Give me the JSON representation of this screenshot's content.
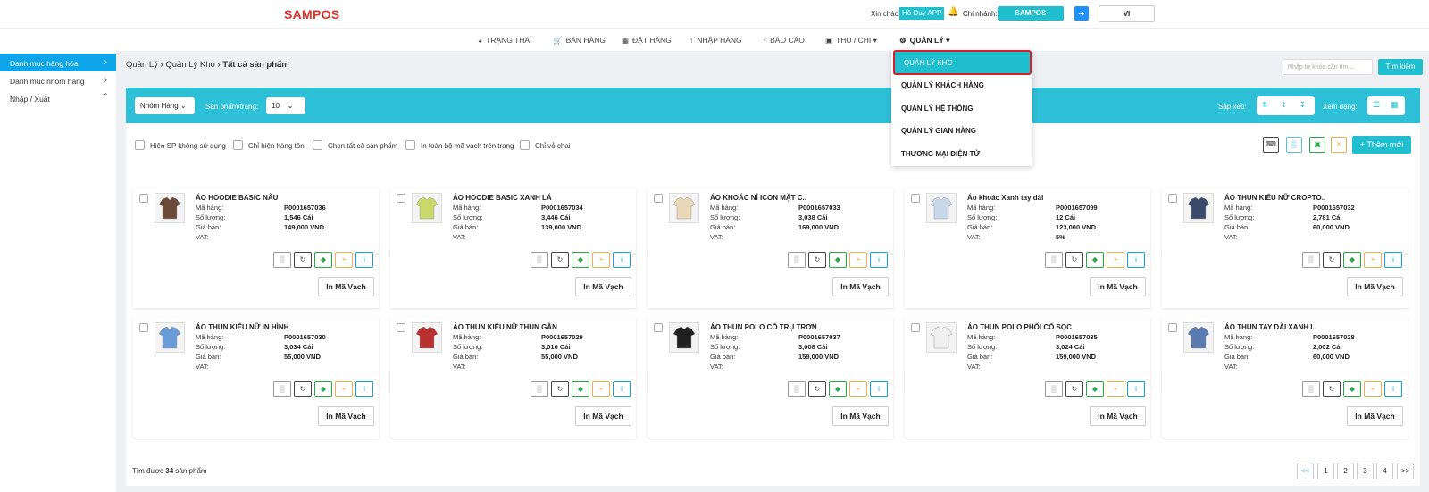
{
  "header": {
    "logo": "SAMPOS",
    "greeting": "Xin chào",
    "user": "Hồ Duy APP",
    "branch_label": "Chi nhánh:",
    "branch": "SAMPOS",
    "lang": "VI"
  },
  "nav": [
    {
      "label": "TRẠNG THÁI",
      "icon": "dashboard-icon"
    },
    {
      "label": "BÁN HÀNG",
      "icon": "cart-icon"
    },
    {
      "label": "ĐẶT HÀNG",
      "icon": "calendar-icon"
    },
    {
      "label": "NHẬP HÀNG",
      "icon": "arrow-up-icon"
    },
    {
      "label": "BÁO CÁO",
      "icon": "pie-chart-icon"
    },
    {
      "label": "THU / CHI",
      "icon": "bank-icon"
    },
    {
      "label": "QUẢN LÝ",
      "icon": "gear-icon"
    }
  ],
  "dropdown": [
    "QUẢN LÝ KHO",
    "QUẢN LÝ KHÁCH HÀNG",
    "QUẢN LÝ HỆ THỐNG",
    "QUẢN LÝ GIAN HÀNG",
    "THƯƠNG MẠI ĐIỆN TỬ"
  ],
  "sidebar": [
    "Danh mục hàng hóa",
    "Danh mục nhóm hàng",
    "Nhập / Xuất"
  ],
  "breadcrumb": {
    "a": "Quản Lý",
    "b": "Quản Lý Kho",
    "c": "Tất cả sản phẩm"
  },
  "search": {
    "placeholder": "Nhập từ khóa cần tìm ...",
    "button": "Tìm kiếm"
  },
  "filter": {
    "group": "Nhóm Hàng",
    "perpage_label": "Sản phẩm/trang:",
    "perpage": "10",
    "sort_label": "Sắp xếp:",
    "view_label": "Xem dạng:"
  },
  "checks": [
    "Hiện SP không sử dụng",
    "Chỉ hiện hàng tồn",
    "Chọn tất cả sản phẩm",
    "In toàn bộ mã vạch trên trang",
    "Chỉ vỏ chai"
  ],
  "add_label": "+ Thêm mới",
  "labels": {
    "code": "Mã hàng:",
    "qty": "Số lượng:",
    "price": "Giá bán:",
    "vat": "VAT:",
    "barcode": "In Mã Vạch"
  },
  "products": [
    {
      "name": "ÁO HOODIE BASIC NÂU",
      "code": "P0001657036",
      "qty": "1,546 Cái",
      "price": "149,000 VND",
      "vat": ""
    },
    {
      "name": "ÁO HOODIE BASIC XANH LÁ",
      "code": "P0001657034",
      "qty": "3,446 Cái",
      "price": "139,000 VND",
      "vat": ""
    },
    {
      "name": "ÁO KHOÁC NỈ ICON MẶT C..",
      "code": "P0001657033",
      "qty": "3,038 Cái",
      "price": "169,000 VND",
      "vat": ""
    },
    {
      "name": "Áo khoác Xanh tay dài",
      "code": "P0001657099",
      "qty": "12 Cái",
      "price": "123,000 VND",
      "vat": "5%"
    },
    {
      "name": "ÁO THUN KIỂU NỮ CROPTO..",
      "code": "P0001657032",
      "qty": "2,781 Cái",
      "price": "60,000 VND",
      "vat": ""
    },
    {
      "name": "ÁO THUN KIỂU NỮ IN HÌNH",
      "code": "P0001657030",
      "qty": "3,034 Cái",
      "price": "55,000 VND",
      "vat": ""
    },
    {
      "name": "ÁO THUN KIỂU NỮ THUN GÂN",
      "code": "P0001657029",
      "qty": "3,010 Cái",
      "price": "55,000 VND",
      "vat": ""
    },
    {
      "name": "ÁO THUN POLO CỔ TRỤ TRƠN",
      "code": "P0001657037",
      "qty": "3,008 Cái",
      "price": "159,000 VND",
      "vat": ""
    },
    {
      "name": "ÁO THUN POLO PHỐI CỔ SỌC",
      "code": "P0001657035",
      "qty": "3,024 Cái",
      "price": "159,000 VND",
      "vat": ""
    },
    {
      "name": "ÁO THUN TAY DÀI XANH I..",
      "code": "P0001657028",
      "qty": "2,002 Cái",
      "price": "60,000 VND",
      "vat": ""
    }
  ],
  "footer": {
    "prefix": "Tìm được",
    "count": "34",
    "suffix": "sản phẩm"
  },
  "pagination": [
    "<<",
    "1",
    "2",
    "3",
    "4",
    ">>"
  ]
}
